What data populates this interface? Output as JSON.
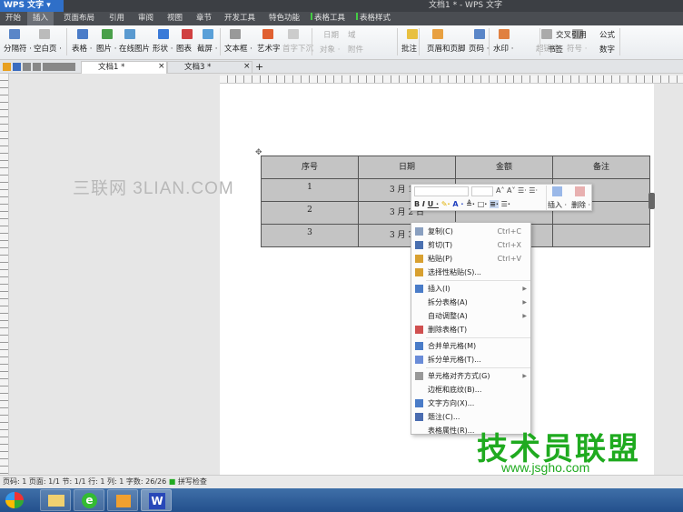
{
  "app": {
    "name": "WPS 文字",
    "window_title": "文档1 * - WPS 文字"
  },
  "menu": {
    "items": [
      "开始",
      "插入",
      "页面布局",
      "引用",
      "审阅",
      "视图",
      "章节",
      "开发工具",
      "特色功能"
    ],
    "tool_tabs": [
      "表格工具",
      "表格样式"
    ],
    "active": "插入"
  },
  "ribbon": {
    "items": [
      {
        "label": "分隔符 ·",
        "color": "#5a86c8"
      },
      {
        "label": "空白页 ·",
        "color": "#bbb"
      },
      {
        "label": "表格 ·",
        "color": "#4a7cc8"
      },
      {
        "label": "图片 ·",
        "color": "#4aa04a"
      },
      {
        "label": "在线图片",
        "color": "#5a9ad0"
      },
      {
        "label": "形状 ·",
        "color": "#3a7ad8"
      },
      {
        "label": "图表",
        "color": "#d04040"
      },
      {
        "label": "截屏 ·",
        "color": "#5aa0d8"
      },
      {
        "label": "文本框 ·",
        "color": "#999"
      },
      {
        "label": "艺术字",
        "color": "#e06030"
      },
      {
        "label": "首字下沉",
        "color": "#ccc",
        "disabled": true
      },
      {
        "label": "批注",
        "color": "#e8c040"
      },
      {
        "label": "页眉和页脚",
        "color": "#e8a040"
      },
      {
        "label": "页码 ·",
        "color": "#5a86c8"
      },
      {
        "label": "水印 ·",
        "color": "#e08040"
      },
      {
        "label": "超链接",
        "color": "#aaa",
        "disabled": true
      },
      {
        "label": "符号 ·",
        "color": "#aaa",
        "disabled": true
      }
    ],
    "small_items": [
      "日期",
      "域",
      "对象 ·",
      "附件",
      "交叉引用",
      "书签",
      "公式",
      "数字"
    ]
  },
  "doc_tabs": [
    "文档1 *",
    "文档3 *"
  ],
  "watermark_left": "三联网 3LIAN.COM",
  "table": {
    "headers": [
      "序号",
      "日期",
      "金额",
      "备注"
    ],
    "rows": [
      [
        "1",
        "3 月 1 日",
        "",
        ""
      ],
      [
        "2",
        "3 月 2 日",
        "",
        ""
      ],
      [
        "3",
        "3 月 3 日",
        "",
        ""
      ]
    ]
  },
  "mini_toolbar": {
    "format_buttons": [
      "B",
      "I",
      "U ·",
      "A ·"
    ],
    "insert": "插入 ·",
    "delete": "删除 ·"
  },
  "context_menu": [
    [
      {
        "label": "复制(C)",
        "shortcut": "Ctrl+C",
        "icon": "copy-icon",
        "color": "#8aa0c0"
      },
      {
        "label": "剪切(T)",
        "shortcut": "Ctrl+X",
        "icon": "cut-icon",
        "color": "#4a70b0"
      },
      {
        "label": "粘贴(P)",
        "shortcut": "Ctrl+V",
        "icon": "paste-icon",
        "color": "#d8a030"
      },
      {
        "label": "选择性粘贴(S)...",
        "icon": "paste-special-icon",
        "color": "#d8a030"
      }
    ],
    [
      {
        "label": "插入(I)",
        "submenu": true,
        "icon": "insert-table-icon",
        "color": "#4a7cc8"
      },
      {
        "label": "拆分表格(A)",
        "submenu": true
      },
      {
        "label": "自动调整(A)",
        "submenu": true
      },
      {
        "label": "删除表格(T)",
        "icon": "delete-table-icon",
        "color": "#d05050"
      }
    ],
    [
      {
        "label": "合并单元格(M)",
        "icon": "merge-cells-icon",
        "color": "#4a7cc8"
      },
      {
        "label": "拆分单元格(T)...",
        "icon": "split-cells-icon",
        "color": "#6a8cd8"
      }
    ],
    [
      {
        "label": "单元格对齐方式(G)",
        "submenu": true,
        "icon": "cell-align-icon",
        "color": "#999"
      },
      {
        "label": "边框和底纹(B)..."
      },
      {
        "label": "文字方向(X)...",
        "icon": "text-direction-icon",
        "color": "#4a7cc8"
      },
      {
        "label": "题注(C)...",
        "icon": "caption-icon",
        "color": "#4a6cb0"
      },
      {
        "label": "表格属性(R)..."
      }
    ]
  ],
  "status": {
    "text": "页码: 1  页面: 1/1  节: 1/1  行: 1  列: 1  字数: 26/26",
    "spell": "拼写检查"
  },
  "watermark_right": {
    "title": "技术员联盟",
    "url": "www.jsgho.com"
  }
}
